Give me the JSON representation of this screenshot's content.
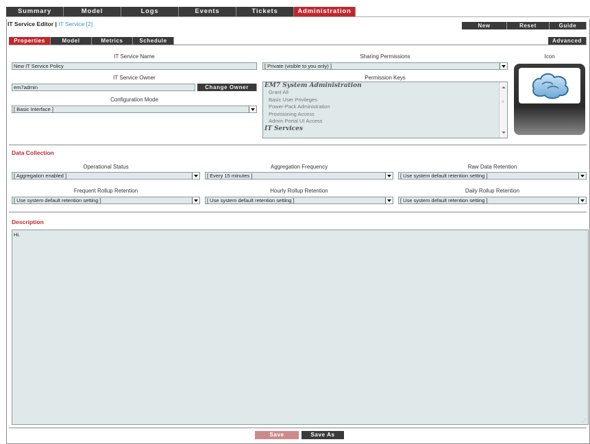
{
  "topnav": [
    {
      "label": "Summary",
      "active": false
    },
    {
      "label": "Model",
      "active": false
    },
    {
      "label": "Logs",
      "active": false
    },
    {
      "label": "Events",
      "active": false
    },
    {
      "label": "Tickets",
      "active": false
    },
    {
      "label": "Administration",
      "active": true
    }
  ],
  "editor": {
    "title": "IT Service Editor |",
    "subtitle": "IT Service [2]"
  },
  "toolbar": {
    "new_label": "New",
    "reset_label": "Reset",
    "guide_label": "Guide"
  },
  "tabs": [
    {
      "label": "Properties",
      "active": true
    },
    {
      "label": "Model",
      "active": false
    },
    {
      "label": "Metrics",
      "active": false
    },
    {
      "label": "Schedule",
      "active": false
    }
  ],
  "advanced_label": "Advanced",
  "properties": {
    "name_label": "IT Service Name",
    "name_value": "New IT Service Policy",
    "owner_label": "IT Service Owner",
    "owner_value": "em7admin",
    "change_owner_label": "Change Owner",
    "config_mode_label": "Configuration Mode",
    "config_mode_value": "[ Basic Interface ]",
    "sharing_label": "Sharing Permissions",
    "sharing_value": "[ Private (visible to you only) ]",
    "perm_keys_label": "Permission Keys",
    "perm_group_1": "EM7 System Administration",
    "perm_items": [
      "Grant All",
      "Basic User Privileges",
      "Power-Pack Administration",
      "Provisioning Access",
      "Admin Portal UI Access"
    ],
    "perm_group_2": "IT Services",
    "icon_label": "Icon"
  },
  "data_collection": {
    "heading": "Data Collection",
    "operational_status_label": "Operational Status",
    "operational_status_value": "[ Aggregation enabled ]",
    "aggregation_frequency_label": "Aggregation Frequency",
    "aggregation_frequency_value": "[ Every 15 minutes ]",
    "raw_retention_label": "Raw Data Retention",
    "raw_retention_value": "[ Use system default retention setting ]",
    "frequent_rollup_label": "Frequent Rollup Retention",
    "frequent_rollup_value": "[ Use system default retention setting ]",
    "hourly_rollup_label": "Hourly Rollup Retention",
    "hourly_rollup_value": "[ Use system default retention setting ]",
    "daily_rollup_label": "Daily Rollup Retention",
    "daily_rollup_value": "[ Use system default retention setting ]"
  },
  "description": {
    "heading": "Description",
    "value": "Hi."
  },
  "footer": {
    "save_label": "Save",
    "save_as_label": "Save As"
  }
}
